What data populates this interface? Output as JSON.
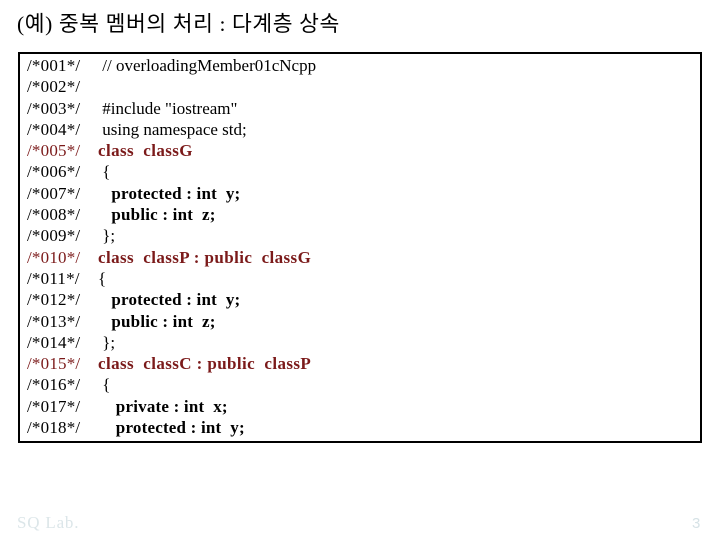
{
  "slide": {
    "title": "(예) 중복 멤버의 처리 : 다계층 상속",
    "page_number": "3",
    "brand": "SQ Lab.",
    "colors": {
      "keyword_maroon": "#7B1A1A",
      "body_black": "#000000",
      "footer_gray": "#DCE6E9",
      "box_border": "#000000",
      "background": "#FFFFFF"
    }
  },
  "code_listing": {
    "lines": [
      {
        "number": "/*001*/",
        "text": " // overloadingMember01cNcpp",
        "style": "plain",
        "number_style": "plain"
      },
      {
        "number": "/*002*/",
        "text": "",
        "style": "plain",
        "number_style": "plain"
      },
      {
        "number": "/*003*/",
        "text": " #include \"iostream\"",
        "style": "plain",
        "number_style": "plain"
      },
      {
        "number": "/*004*/",
        "text": " using namespace std;",
        "style": "plain",
        "number_style": "plain"
      },
      {
        "number": "/*005*/",
        "text": "class  classG",
        "style": "maroon",
        "number_style": "maroon"
      },
      {
        "number": "/*006*/",
        "text": " {",
        "style": "plain",
        "number_style": "plain"
      },
      {
        "number": "/*007*/",
        "text": "   protected : int  y;",
        "style": "bold",
        "number_style": "plain"
      },
      {
        "number": "/*008*/",
        "text": "   public : int  z;",
        "style": "bold",
        "number_style": "plain"
      },
      {
        "number": "/*009*/",
        "text": " };",
        "style": "plain",
        "number_style": "plain"
      },
      {
        "number": "/*010*/",
        "text": "class  classP : public  classG",
        "style": "maroon",
        "number_style": "maroon"
      },
      {
        "number": "/*011*/",
        "text": "{",
        "style": "plain",
        "number_style": "plain"
      },
      {
        "number": "/*012*/",
        "text": "   protected : int  y;",
        "style": "bold",
        "number_style": "plain"
      },
      {
        "number": "/*013*/",
        "text": "   public : int  z;",
        "style": "bold",
        "number_style": "plain"
      },
      {
        "number": "/*014*/",
        "text": " };",
        "style": "plain",
        "number_style": "plain"
      },
      {
        "number": "/*015*/",
        "text": "class  classC : public  classP",
        "style": "maroon",
        "number_style": "maroon"
      },
      {
        "number": "/*016*/",
        "text": " {",
        "style": "plain",
        "number_style": "plain"
      },
      {
        "number": "/*017*/",
        "text": "    private : int  x;",
        "style": "bold",
        "number_style": "plain"
      },
      {
        "number": "/*018*/",
        "text": "    protected : int  y;",
        "style": "bold",
        "number_style": "plain"
      }
    ]
  }
}
